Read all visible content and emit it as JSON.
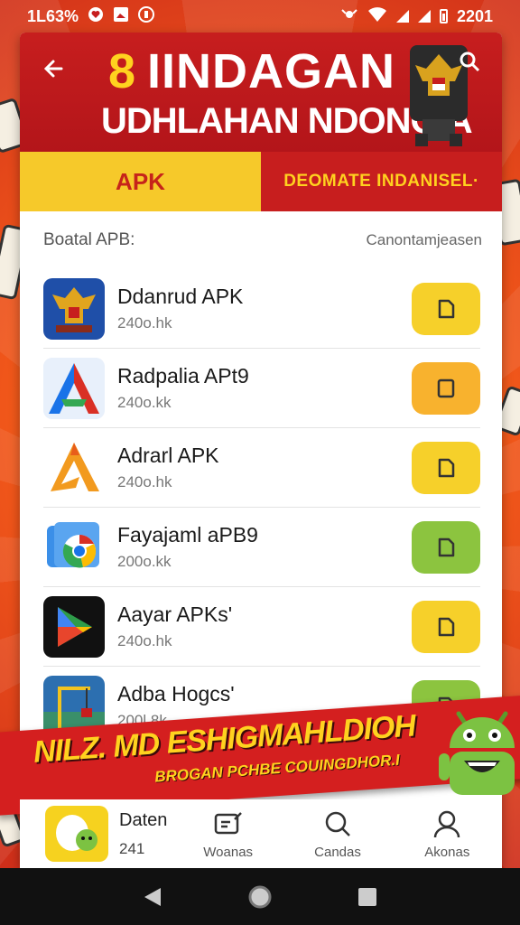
{
  "status_bar": {
    "left_text": "1L63%",
    "time": "2201",
    "icons": [
      "heart-icon",
      "image-icon",
      "shield-icon",
      "settings-icon",
      "wifi-icon",
      "signal-icon",
      "battery-icon"
    ]
  },
  "header": {
    "title_number": "8",
    "title_line1": "IINDAGAN",
    "title_line2": "UDHLAHAN NDONOIA",
    "back_icon": "arrow-left-icon",
    "search_icon": "search-icon",
    "emblem_icon": "garuda-emblem-icon"
  },
  "tabs": [
    {
      "label": "APK",
      "active": true
    },
    {
      "label": "DEOMATE INDANISEL·",
      "active": false
    }
  ],
  "list_header": {
    "left": "Boatal APB:",
    "right": "Canontamjeasen"
  },
  "apps": [
    {
      "name": "Ddanrud APK",
      "size": "240o.hk",
      "icon": "garuda-app-icon",
      "button_color": "#f6d02a"
    },
    {
      "name": "Radpalia APt9",
      "size": "240o.kk",
      "icon": "triangle-a-app-icon",
      "button_color": "#f8b22e"
    },
    {
      "name": "Adrarl APK",
      "size": "240o.hk",
      "icon": "flame-a-app-icon",
      "button_color": "#f6d02a"
    },
    {
      "name": "Fayajaml aPB9",
      "size": "200o.kk",
      "icon": "chrome-app-icon",
      "button_color": "#8cc43f"
    },
    {
      "name": "Aayar APKs'",
      "size": "240o.hk",
      "icon": "play-store-app-icon",
      "button_color": "#f6d02a"
    },
    {
      "name": "Adba Hogcs'",
      "size": "200l.8k",
      "icon": "crane-apk-app-icon",
      "button_color": "#8cc43f"
    }
  ],
  "banner": {
    "main": "NILZ. MD ESHIGMAHLDIOH",
    "sub": "BROGAN PCHBE COUINGDHOR.I"
  },
  "bottom_nav": {
    "peek": {
      "name": "Daten",
      "size": "241"
    },
    "items": [
      {
        "label": "Woanas",
        "icon": "edit-icon"
      },
      {
        "label": "Candas",
        "icon": "search-icon"
      },
      {
        "label": "Akonas",
        "icon": "profile-icon"
      }
    ]
  },
  "colors": {
    "primary_red": "#c71e1e",
    "accent_yellow": "#f6c92a",
    "green": "#8cc43f",
    "orange": "#f8b22e"
  }
}
